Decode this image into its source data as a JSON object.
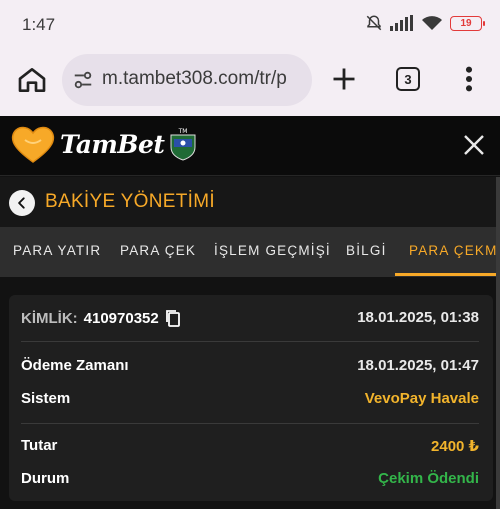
{
  "status": {
    "time": "1:47",
    "battery": "19"
  },
  "browser": {
    "url": "m.tambet308.com/tr/p",
    "tab_count": "3"
  },
  "site": {
    "logo_text": "TamBet",
    "logo_badge": "TM"
  },
  "page": {
    "title": "BAKİYE YÖNETİMİ"
  },
  "tabs": [
    {
      "label": "PARA YATIR"
    },
    {
      "label": "PARA ÇEK"
    },
    {
      "label": "İŞLEM GEÇMİŞİ"
    },
    {
      "label": "BİLGİ"
    },
    {
      "label": "PARA ÇEKME"
    }
  ],
  "record": {
    "id_label": "KİMLİK:",
    "id_value": "410970352",
    "created": "18.01.2025, 01:38",
    "payment_time_label": "Ödeme Zamanı",
    "payment_time": "18.01.2025, 01:47",
    "system_label": "Sistem",
    "system": "VevoPay Havale",
    "amount_label": "Tutar",
    "amount": "2400 ₺",
    "status_label": "Durum",
    "status": "Çekim Ödendi"
  },
  "colors": {
    "accent": "#f7a928",
    "success": "#33b54a",
    "bg": "#121212"
  }
}
